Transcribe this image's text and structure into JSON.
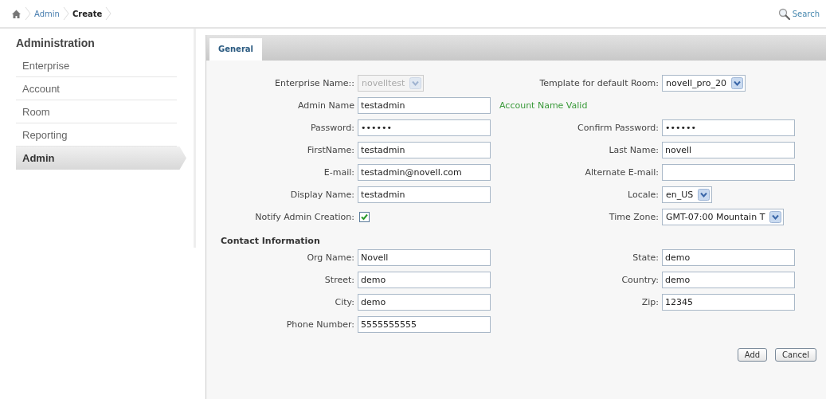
{
  "breadcrumb": [
    {
      "label": "Admin",
      "kind": "link"
    },
    {
      "label": "Create",
      "kind": "current"
    }
  ],
  "search_link": "Search",
  "sidebar": {
    "title": "Administration",
    "items": [
      {
        "label": "Enterprise",
        "selected": false
      },
      {
        "label": "Account",
        "selected": false
      },
      {
        "label": "Room",
        "selected": false
      },
      {
        "label": "Reporting",
        "selected": false
      },
      {
        "label": "Admin",
        "selected": true
      }
    ]
  },
  "tabs": [
    {
      "label": "General",
      "selected": true
    }
  ],
  "form": {
    "rows": [
      {
        "left": {
          "kind": "select",
          "label": "Enterprise Name::",
          "value": "novelltest",
          "disabled": true
        },
        "right": {
          "kind": "select",
          "label": "Template for default Room:",
          "value": "novell_pro_20",
          "disabled": false
        }
      },
      {
        "left": {
          "kind": "text",
          "label": "Admin Name",
          "value": "testadmin"
        },
        "right": {
          "kind": "status",
          "text": "Account Name Valid"
        }
      },
      {
        "left": {
          "kind": "password",
          "label": "Password:",
          "value": "••••••"
        },
        "right": {
          "kind": "password",
          "label": "Confirm Password:",
          "value": "••••••"
        }
      },
      {
        "left": {
          "kind": "text",
          "label": "FirstName:",
          "value": "testadmin"
        },
        "right": {
          "kind": "text",
          "label": "Last Name:",
          "value": "novell"
        }
      },
      {
        "left": {
          "kind": "text",
          "label": "E-mail:",
          "value": "testadmin@novell.com"
        },
        "right": {
          "kind": "text",
          "label": "Alternate E-mail:"
        }
      },
      {
        "left": {
          "kind": "text",
          "label": "Display Name:",
          "value": "testadmin"
        },
        "right": {
          "kind": "select",
          "label": "Locale:",
          "value": "en_US",
          "disabled": false
        }
      },
      {
        "left": {
          "kind": "checkbox",
          "label": "Notify Admin Creation:",
          "checked": true
        },
        "right": {
          "kind": "select",
          "label": "Time Zone:",
          "value": "GMT-07:00 Mountain T",
          "disabled": false
        }
      }
    ]
  },
  "contact": {
    "title": "Contact Information",
    "rows": [
      {
        "left": {
          "kind": "text",
          "label": "Org Name:",
          "value": "Novell"
        },
        "right": {
          "kind": "text",
          "label": "State:",
          "value": "demo"
        }
      },
      {
        "left": {
          "kind": "text",
          "label": "Street:",
          "value": "demo"
        },
        "right": {
          "kind": "text",
          "label": "Country:",
          "value": "demo"
        }
      },
      {
        "left": {
          "kind": "text",
          "label": "City:",
          "value": "demo"
        },
        "right": {
          "kind": "text",
          "label": "Zip:",
          "value": "12345"
        }
      },
      {
        "left": {
          "kind": "text",
          "label": "Phone Number:",
          "value": "5555555555"
        }
      }
    ]
  },
  "buttons": [
    "Add",
    "Cancel"
  ]
}
